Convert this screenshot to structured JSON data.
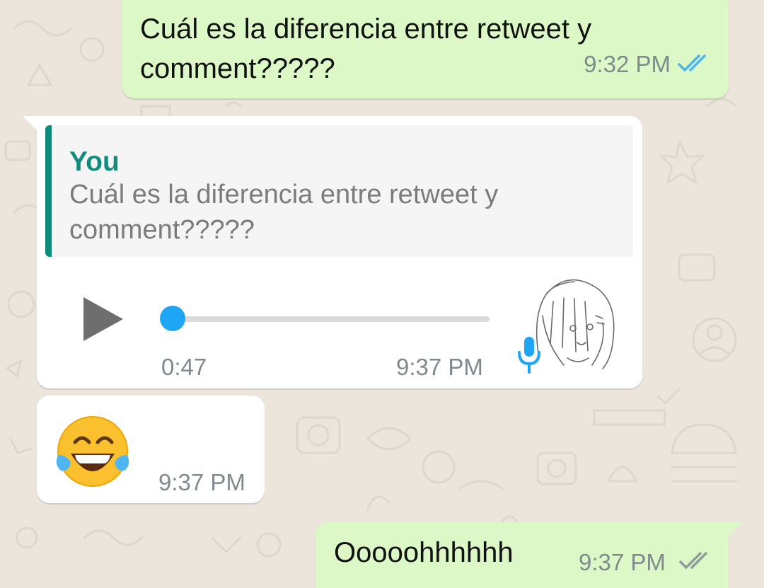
{
  "messages": [
    {
      "direction": "outgoing",
      "text": "Cuál es la diferencia entre retweet y comment?????",
      "time": "9:32 PM",
      "status": "read"
    },
    {
      "direction": "incoming",
      "quoted": {
        "author": "You",
        "text": "Cuál es la diferencia entre retweet y comment?????"
      },
      "voice": {
        "duration": "0:47",
        "progress": 0
      },
      "time": "9:37 PM"
    },
    {
      "direction": "incoming",
      "emoji": "face-with-tears-of-joy",
      "time": "9:37 PM"
    },
    {
      "direction": "outgoing",
      "text": "Ooooohhhhhh",
      "time": "9:37 PM",
      "status": "delivered"
    }
  ],
  "colors": {
    "outgoing_bubble": "#dcf8c6",
    "incoming_bubble": "#ffffff",
    "background": "#ece5dc",
    "read_ticks": "#4fb5e6",
    "delivered_ticks": "#8f9a9e",
    "quote_accent": "#128c7e",
    "audio_accent": "#1ea5f5"
  },
  "icons": [
    "double-check-icon",
    "play-icon",
    "microphone-icon",
    "face-with-tears-of-joy-emoji"
  ]
}
